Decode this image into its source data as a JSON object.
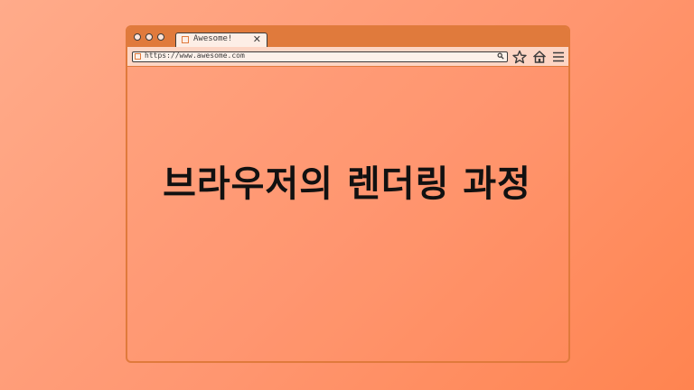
{
  "browser": {
    "tab": {
      "title": "Awesome!",
      "close_icon": "close-icon"
    },
    "address_bar": {
      "url": "https://www.awesome.com"
    },
    "controls": [
      "star-icon",
      "home-icon",
      "menu-icon"
    ]
  },
  "headline": "브라우저의 렌더링 과정",
  "colors": {
    "background_start": "#ffab8a",
    "background_end": "#ff8450",
    "frame": "#e07a3c",
    "text": "#111111"
  }
}
